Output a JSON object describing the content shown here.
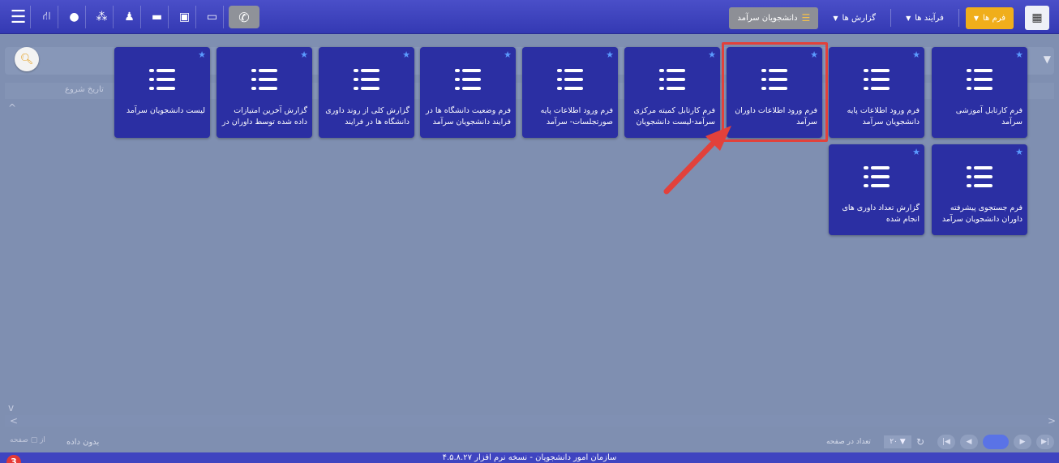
{
  "topbar": {
    "nav_icons": [
      "menu-icon",
      "org-chart-icon",
      "user-icon",
      "users-icon",
      "profile-icon",
      "chat-icon",
      "id-card-icon",
      "folder-icon",
      "phone-icon"
    ],
    "tabs": [
      {
        "label": "فرم ها",
        "style": "active"
      },
      {
        "label": "فرآیند ها",
        "style": "normal"
      },
      {
        "label": "گزارش ها",
        "style": "normal"
      }
    ],
    "module_tab": "دانشجویان سرآمد"
  },
  "grid": {
    "column_start_date": "تاریخ شروع",
    "no_data": "بدون داده",
    "page_label": "صفحه",
    "page_of": "از",
    "page_size": "۲۰",
    "page_size_label": "تعداد در صفحه"
  },
  "footer": {
    "text": "سازمان امور دانشجویان - نسخه نرم افزار ۴.۵.۸.۲۷",
    "help_count": "3"
  },
  "tiles": [
    {
      "text": "فرم کارتابل آموزشی سرآمد"
    },
    {
      "text": "فرم ورود اطلاعات پایه دانشجویان سرآمد"
    },
    {
      "text": "فرم ورود اطلاعات داوران سرآمد"
    },
    {
      "text": "فرم کارتابل کمیته مرکزی سرآمد-لیست دانشجویان"
    },
    {
      "text": "فرم ورود اطلاعات پایه صورتجلسات- سرآمد"
    },
    {
      "text": "فرم وضعیت دانشگاه ها در فرایند دانشجویان سرآمد"
    },
    {
      "text": "گزارش کلی از روند داوری دانشگاه ها در فرایند"
    },
    {
      "text": "گزارش آخرین امتیازات داده شده توسط داوران در"
    },
    {
      "text": "لیست دانشجویان سرآمد"
    },
    {
      "text": "فرم جستجوی پیشرفته داوران دانشجویان سرآمد"
    },
    {
      "text": "گزارش تعداد داوری های انجام شده"
    }
  ],
  "colors": {
    "topbar": "#3a3fc0",
    "tile": "#2b2fa3",
    "accent": "#f0ae1b",
    "highlight": "#e2413b",
    "star": "#5b9bff"
  }
}
